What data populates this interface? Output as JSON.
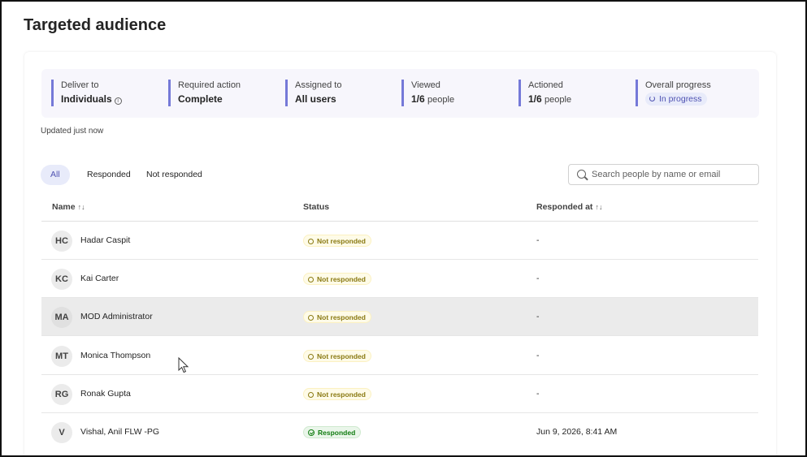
{
  "page": {
    "title": "Targeted audience"
  },
  "summary": {
    "deliver_to": {
      "label": "Deliver to",
      "value": "Individuals"
    },
    "required_action": {
      "label": "Required action",
      "value": "Complete"
    },
    "assigned_to": {
      "label": "Assigned to",
      "value": "All users"
    },
    "viewed": {
      "label": "Viewed",
      "value": "1/6",
      "unit": "people",
      "count": 1,
      "total": 6
    },
    "actioned": {
      "label": "Actioned",
      "value": "1/6",
      "unit": "people",
      "count": 1,
      "total": 6
    },
    "overall_progress": {
      "label": "Overall progress",
      "value": "In progress"
    },
    "accent_color": "#7579d8"
  },
  "updated_text": "Updated just now",
  "filters": {
    "tabs": [
      {
        "label": "All",
        "active": true
      },
      {
        "label": "Responded",
        "active": false
      },
      {
        "label": "Not responded",
        "active": false
      }
    ]
  },
  "search": {
    "placeholder": "Search people by name or email",
    "value": ""
  },
  "table": {
    "columns": {
      "name": "Name",
      "status": "Status",
      "responded_at": "Responded at"
    },
    "sort_glyph": "↑↓",
    "rows": [
      {
        "initials": "HC",
        "name": "Hadar Caspit",
        "status": "Not responded",
        "responded_at": "-"
      },
      {
        "initials": "KC",
        "name": "Kai Carter",
        "status": "Not responded",
        "responded_at": "-"
      },
      {
        "initials": "MA",
        "name": "MOD Administrator",
        "status": "Not responded",
        "responded_at": "-"
      },
      {
        "initials": "MT",
        "name": "Monica Thompson",
        "status": "Not responded",
        "responded_at": "-"
      },
      {
        "initials": "RG",
        "name": "Ronak Gupta",
        "status": "Not responded",
        "responded_at": "-"
      },
      {
        "initials": "V",
        "name": "Vishal, Anil FLW -PG",
        "status": "Responded",
        "responded_at": "Jun 9, 2026, 8:41 AM"
      }
    ]
  },
  "colors": {
    "not_responded": "#8a7a12",
    "responded": "#107c10",
    "brand": "#4f52b2"
  }
}
